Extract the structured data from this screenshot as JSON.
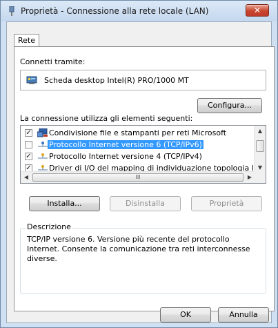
{
  "window": {
    "title": "Proprietà - Connessione alla rete locale (LAN)",
    "close_label": "✕"
  },
  "tabs": [
    {
      "label": "Rete"
    }
  ],
  "connect_label": "Connetti tramite:",
  "adapter_name": "Scheda desktop Intel(R) PRO/1000 MT",
  "configure_button": "Configura...",
  "items_label": "La connessione utilizza gli elementi seguenti:",
  "items": [
    {
      "label": "Condivisione file e stampanti per reti Microsoft",
      "checked": true,
      "selected": false,
      "icon": "network-service-icon"
    },
    {
      "label": "Protocollo Internet versione 6 (TCP/IPv6)",
      "checked": false,
      "selected": true,
      "icon": "protocol-icon"
    },
    {
      "label": "Protocollo Internet versione 4 (TCP/IPv4)",
      "checked": true,
      "selected": false,
      "icon": "protocol-icon"
    },
    {
      "label": "Driver di I/O del mapping di individuazione topologia liv",
      "checked": true,
      "selected": false,
      "icon": "protocol-icon"
    }
  ],
  "actions": {
    "install": "Installa...",
    "uninstall": "Disinstalla",
    "properties": "Proprietà"
  },
  "description": {
    "legend": "Descrizione",
    "text": "TCP/IP versione 6. Versione più recente del protocollo Internet. Consente la comunicazione tra reti interconnesse diverse."
  },
  "footer": {
    "ok": "OK",
    "cancel": "Annulla"
  },
  "colors": {
    "selection": "#3399ff",
    "close_button": "#c8452c"
  }
}
